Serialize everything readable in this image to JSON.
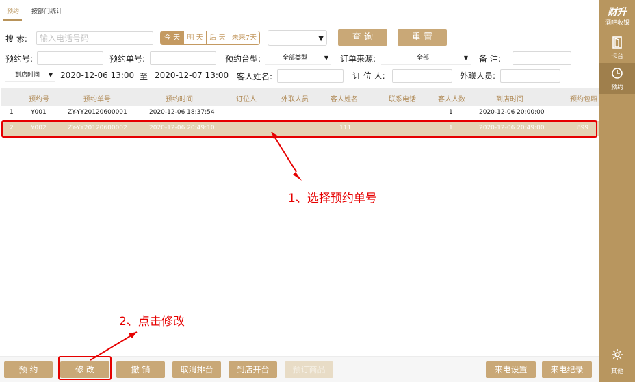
{
  "tabs": [
    "预约",
    "按部门统计"
  ],
  "search": {
    "label": "搜  索:",
    "placeholder": "输入电话号码",
    "segments": [
      "今 天",
      "明 天",
      "后 天",
      "未来7天"
    ],
    "dropdown_value": "",
    "query_btn": "查 询",
    "reset_btn": "重 置"
  },
  "filters": {
    "booking_no_label": "预约号:",
    "booking_order_label": "预约单号:",
    "table_type_label": "预约台型:",
    "table_type_value": "全部类型",
    "source_label": "订单来源:",
    "source_value": "全部",
    "remark_label": "备  注:",
    "time_type_value": "到店时间",
    "date_from": "2020-12-06 13:00",
    "to_label": "至",
    "date_to": "2020-12-07 13:00",
    "guest_name_label": "客人姓名:",
    "booker_label": "订 位 人:",
    "liaison_label": "外联人员:"
  },
  "table": {
    "headers": [
      "预约号",
      "预约单号",
      "预约时间",
      "订位人",
      "外联人员",
      "客人姓名",
      "联系电话",
      "客人人数",
      "到店时间",
      "预约包厢"
    ],
    "rows": [
      {
        "idx": "1",
        "no": "Y001",
        "order": "ZY-YY20120600001",
        "time": "2020-12-06 18:37:54",
        "booker": "",
        "liaison": "",
        "guest": "",
        "phone": "",
        "count": "1",
        "arrive": "2020-12-06 20:00:00",
        "room": ""
      },
      {
        "idx": "2",
        "no": "Y002",
        "order": "ZY-YY20120600002",
        "time": "2020-12-06 20:49:10",
        "booker": "",
        "liaison": "",
        "guest": "111",
        "phone": "",
        "count": "1",
        "arrive": "2020-12-06 20:49:00",
        "room": "899"
      }
    ]
  },
  "annotations": {
    "step1": "1、选择预约单号",
    "step2": "2、点击修改"
  },
  "bottom": {
    "book": "预 约",
    "modify": "修 改",
    "cancel": "撤 销",
    "cancel_queue": "取消排台",
    "arrive_open": "到店开台",
    "preorder": "预订商品",
    "call_settings": "来电设置",
    "call_log": "来电纪录"
  },
  "sidebar": {
    "brand": "财升",
    "brand_sub": "酒吧收银",
    "items": [
      "卡台",
      "预约",
      "其他"
    ]
  },
  "colors": {
    "accent": "#c9a877",
    "sidebar": "#b8965f",
    "annotation": "#e60000"
  }
}
